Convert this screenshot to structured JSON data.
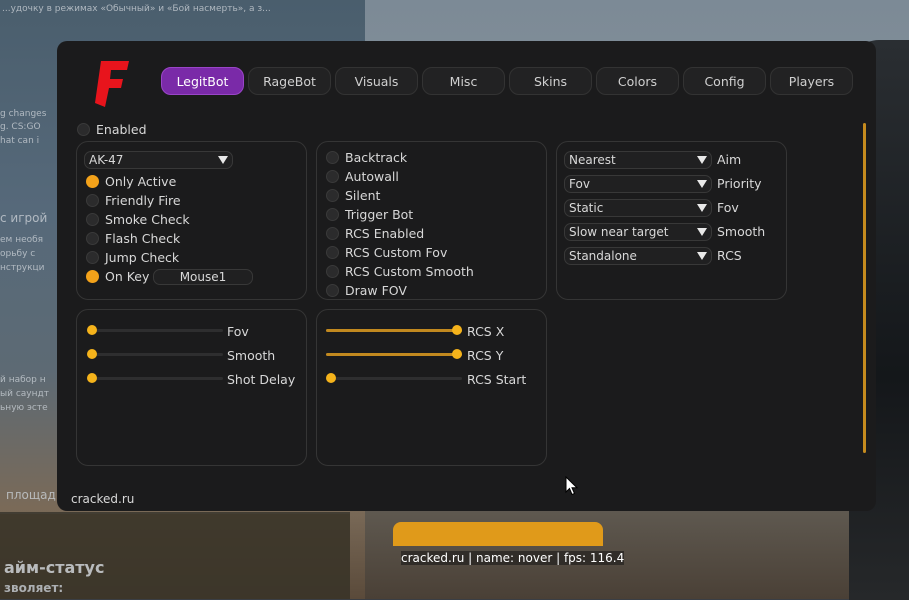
{
  "background": {
    "left_texts": [
      "...удочку в режимах «Обычный» и «Бой насмерть», а з...",
      "g changes",
      "g. CS:GO",
      "hat can i",
      "с игрой",
      "ем необя",
      "орьбу с",
      "нструкци",
      "й набор н",
      "ый саундт",
      "ьную эсте",
      "площад",
      "айм-статус",
      "зволяет:"
    ]
  },
  "status_bar": {
    "text": "cracked.ru | name: nover | fps: 116.4"
  },
  "menu": {
    "logo_letter": "F",
    "logo_color": "#e8141c",
    "accent_color": "#f3a21a",
    "active_tab_color": "#7a2aa8",
    "tabs": [
      {
        "label": "LegitBot",
        "active": true
      },
      {
        "label": "RageBot",
        "active": false
      },
      {
        "label": "Visuals",
        "active": false
      },
      {
        "label": "Misc",
        "active": false
      },
      {
        "label": "Skins",
        "active": false
      },
      {
        "label": "Colors",
        "active": false
      },
      {
        "label": "Config",
        "active": false
      },
      {
        "label": "Players",
        "active": false
      }
    ],
    "enabled": {
      "label": "Enabled",
      "checked": false
    },
    "weapon_panel": {
      "weapon_select": "AK-47",
      "checks": [
        {
          "label": "Only Active",
          "checked": true
        },
        {
          "label": "Friendly Fire",
          "checked": false
        },
        {
          "label": "Smoke Check",
          "checked": false
        },
        {
          "label": "Flash Check",
          "checked": false
        },
        {
          "label": "Jump Check",
          "checked": false
        },
        {
          "label": "On Key",
          "checked": true
        }
      ],
      "key_bind": "Mouse1"
    },
    "feature_panel": {
      "checks": [
        {
          "label": "Backtrack",
          "checked": false
        },
        {
          "label": "Autowall",
          "checked": false
        },
        {
          "label": "Silent",
          "checked": false
        },
        {
          "label": "Trigger Bot",
          "checked": false
        },
        {
          "label": "RCS Enabled",
          "checked": false
        },
        {
          "label": "RCS Custom Fov",
          "checked": false
        },
        {
          "label": "RCS Custom Smooth",
          "checked": false
        },
        {
          "label": "Draw FOV",
          "checked": false
        }
      ]
    },
    "options_panel": {
      "selects": [
        {
          "value": "Nearest",
          "label": "Aim"
        },
        {
          "value": "Fov",
          "label": "Priority"
        },
        {
          "value": "Static",
          "label": "Fov"
        },
        {
          "value": "Slow near target",
          "label": "Smooth"
        },
        {
          "value": "Standalone",
          "label": "RCS"
        }
      ]
    },
    "aim_sliders": [
      {
        "label": "Fov",
        "value": 0
      },
      {
        "label": "Smooth",
        "value": 0
      },
      {
        "label": "Shot Delay",
        "value": 0
      }
    ],
    "rcs_sliders": [
      {
        "label": "RCS X",
        "value": 1
      },
      {
        "label": "RCS Y",
        "value": 1
      },
      {
        "label": "RCS Start",
        "value": 0
      }
    ],
    "footer": "cracked.ru"
  }
}
